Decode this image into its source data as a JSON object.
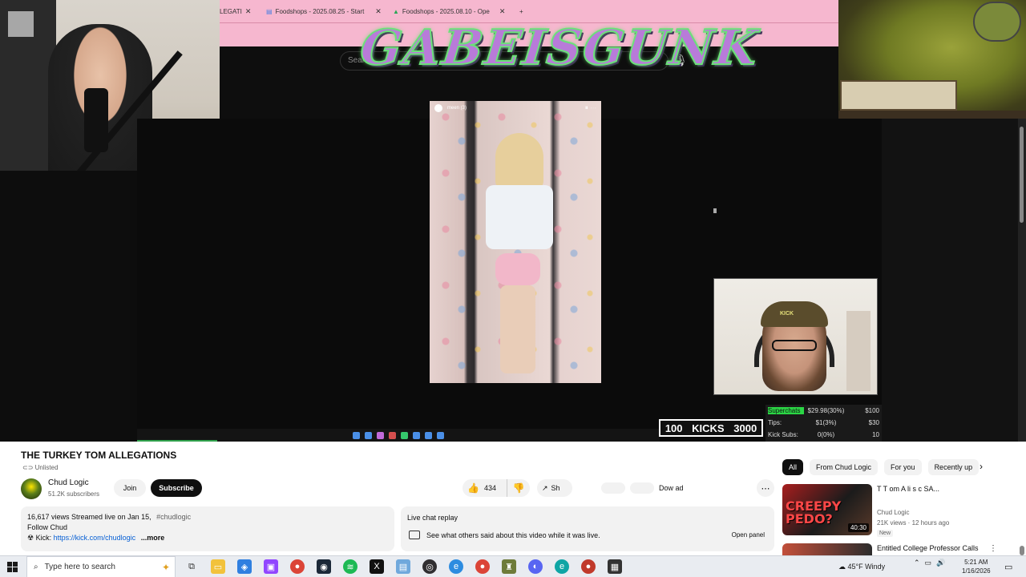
{
  "browser": {
    "tabs": [
      {
        "label": "LEGATI",
        "icon": "page-icon"
      },
      {
        "label": "Foodshops - 2025.08.25 - Start",
        "icon": "docs-icon"
      },
      {
        "label": "Foodshops - 2025.08.10 - Ope",
        "icon": "drive-icon"
      }
    ],
    "new_tab": "+",
    "search_placeholder": "Searc"
  },
  "overlay": {
    "logo_text": "GABEISGUNK",
    "kicks_left": "100",
    "kicks_label": "KICKS",
    "kicks_right": "3000",
    "stats": [
      {
        "label": "Superchats",
        "value": "$29.98(30%)",
        "goal": "$100",
        "highlight": true
      },
      {
        "label": "Tips:",
        "value": "$1(3%)",
        "goal": "$30",
        "highlight": false
      },
      {
        "label": "Kick Subs:",
        "value": "0(0%)",
        "goal": "10",
        "highlight": false
      }
    ],
    "cam2_cap_text": "KICK"
  },
  "photo": {
    "username": "meen (3)",
    "controls": "⏸ ⋯"
  },
  "video": {
    "title": "THE TURKEY TOM ALLEGATIONS",
    "visibility": "Unlisted",
    "channel": "Chud Logic",
    "subscribers": "51.2K subscribers",
    "join_label": "Join",
    "subscribe_label": "Subscribe",
    "likes": "434",
    "share_label": "Sh",
    "download_label": "Dow  ad",
    "more_icon": "⋯",
    "description": {
      "meta": "16,617 views  Streamed live on Jan 15,",
      "hashtag": "#chudlogic",
      "line2": "Follow Chud",
      "kick_prefix": "Kick:",
      "kick_link": "https://kick.com/chudlogic",
      "more": "...more"
    },
    "chat": {
      "header": "Live chat replay",
      "text": "See what others said about this video while it was live.",
      "button": "Open panel"
    }
  },
  "recommendations": {
    "chips": [
      "All",
      "From Chud Logic",
      "For you",
      "Recently up"
    ],
    "items": [
      {
        "thumb_text": "CREEPY\nPEDO?",
        "duration": "40:30",
        "title": "T  T   om A  li  s  c   SA...",
        "channel": "Chud Logic",
        "views": "21K views · 12 hours ago",
        "badge": "New"
      },
      {
        "title": "Entitled College Professor Calls"
      }
    ]
  },
  "taskbar": {
    "search_placeholder": "Type here to search",
    "weather": "45°F  Windy",
    "time": "5:21 AM",
    "date": "1/16/2026",
    "apps": [
      "task-view-icon",
      "file-explorer-icon",
      "store-icon",
      "twitch-icon",
      "chrome-icon",
      "steam-icon",
      "spotify-icon",
      "x-icon",
      "notepad-icon",
      "obs-icon",
      "edge-icon",
      "chrome-icon",
      "game-icon",
      "discord-icon",
      "edge-icon",
      "app-icon",
      "app-icon"
    ]
  },
  "colors": {
    "browser_bar": "#f6b7cf",
    "superchat_green": "#2bd645",
    "link_blue": "#065fd4"
  }
}
